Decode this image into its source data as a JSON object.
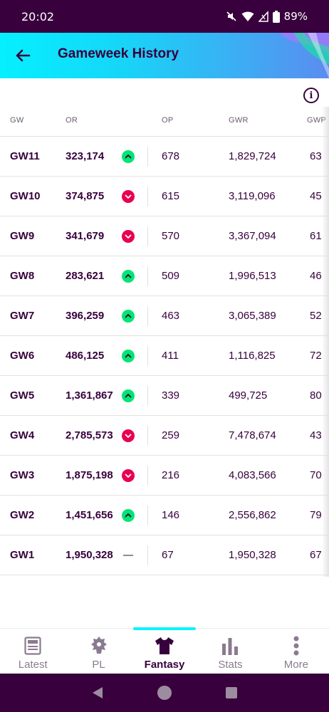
{
  "status_bar": {
    "time": "20:02",
    "battery": "89%"
  },
  "header": {
    "title": "Gameweek History"
  },
  "table": {
    "columns": {
      "gw": "GW",
      "or": "OR",
      "op": "OP",
      "gwr": "GWR",
      "gwp": "GWP"
    },
    "rows": [
      {
        "gw": "GW11",
        "or": "323,174",
        "trend": "up",
        "op": "678",
        "gwr": "1,829,724",
        "gwp": "63"
      },
      {
        "gw": "GW10",
        "or": "374,875",
        "trend": "down",
        "op": "615",
        "gwr": "3,119,096",
        "gwp": "45"
      },
      {
        "gw": "GW9",
        "or": "341,679",
        "trend": "down",
        "op": "570",
        "gwr": "3,367,094",
        "gwp": "61"
      },
      {
        "gw": "GW8",
        "or": "283,621",
        "trend": "up",
        "op": "509",
        "gwr": "1,996,513",
        "gwp": "46"
      },
      {
        "gw": "GW7",
        "or": "396,259",
        "trend": "up",
        "op": "463",
        "gwr": "3,065,389",
        "gwp": "52"
      },
      {
        "gw": "GW6",
        "or": "486,125",
        "trend": "up",
        "op": "411",
        "gwr": "1,116,825",
        "gwp": "72"
      },
      {
        "gw": "GW5",
        "or": "1,361,867",
        "trend": "up",
        "op": "339",
        "gwr": "499,725",
        "gwp": "80"
      },
      {
        "gw": "GW4",
        "or": "2,785,573",
        "trend": "down",
        "op": "259",
        "gwr": "7,478,674",
        "gwp": "43"
      },
      {
        "gw": "GW3",
        "or": "1,875,198",
        "trend": "down",
        "op": "216",
        "gwr": "4,083,566",
        "gwp": "70"
      },
      {
        "gw": "GW2",
        "or": "1,451,656",
        "trend": "up",
        "op": "146",
        "gwr": "2,556,862",
        "gwp": "79"
      },
      {
        "gw": "GW1",
        "or": "1,950,328",
        "trend": "same",
        "op": "67",
        "gwr": "1,950,328",
        "gwp": "67"
      }
    ]
  },
  "bottom_nav": {
    "items": [
      {
        "label": "Latest",
        "icon": "news-icon"
      },
      {
        "label": "PL",
        "icon": "premier-league-lion-icon"
      },
      {
        "label": "Fantasy",
        "icon": "shirt-icon"
      },
      {
        "label": "Stats",
        "icon": "bar-chart-icon"
      },
      {
        "label": "More",
        "icon": "more-vertical-icon"
      }
    ],
    "active": "Fantasy"
  },
  "colors": {
    "primary": "#37003c",
    "up": "#00e573",
    "down": "#e90052",
    "accent": "#04f5ff"
  }
}
